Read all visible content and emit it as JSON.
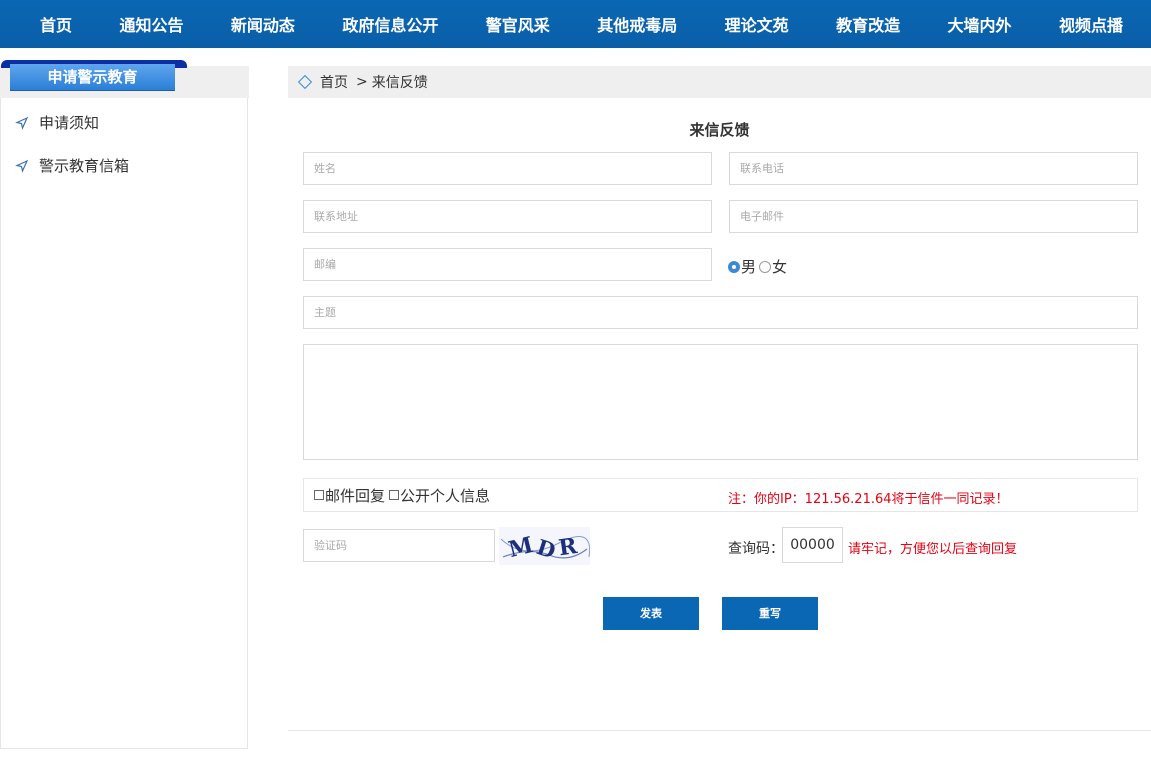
{
  "nav": {
    "items": [
      "首页",
      "通知公告",
      "新闻动态",
      "政府信息公开",
      "警官风采",
      "其他戒毒局",
      "理论文苑",
      "教育改造",
      "大墙内外",
      "视频点播"
    ]
  },
  "sidebar": {
    "title": "申请警示教育",
    "items": [
      {
        "label": "申请须知",
        "icon": "send-icon"
      },
      {
        "label": "警示教育信箱",
        "icon": "send-icon"
      }
    ]
  },
  "breadcrumb": {
    "home": "首页",
    "separator": ">",
    "current": "来信反馈"
  },
  "form": {
    "title": "来信反馈",
    "name_placeholder": "姓名",
    "phone_placeholder": "联系电话",
    "address_placeholder": "联系地址",
    "email_placeholder": "电子邮件",
    "zip_placeholder": "邮编",
    "gender": {
      "male": "男",
      "female": "女",
      "selected": "男"
    },
    "subject_placeholder": "主题",
    "content_placeholder": "",
    "email_reply_label": "邮件回复",
    "public_info_label": "公开个人信息",
    "ip_note": "注：你的IP：121.56.21.64将于信件一同记录！",
    "captcha_placeholder": "验证码",
    "captcha_text": "MDR",
    "query_label": "查询码：",
    "query_code": "00000",
    "query_note": "请牢记，方便您以后查询回复",
    "submit_label": "发表",
    "reset_label": "重写"
  },
  "colors": {
    "nav_bg": "#0a67b3",
    "accent": "#3a8ad8",
    "warning": "#e60012",
    "ribbon_dark": "#0b2fa6"
  }
}
